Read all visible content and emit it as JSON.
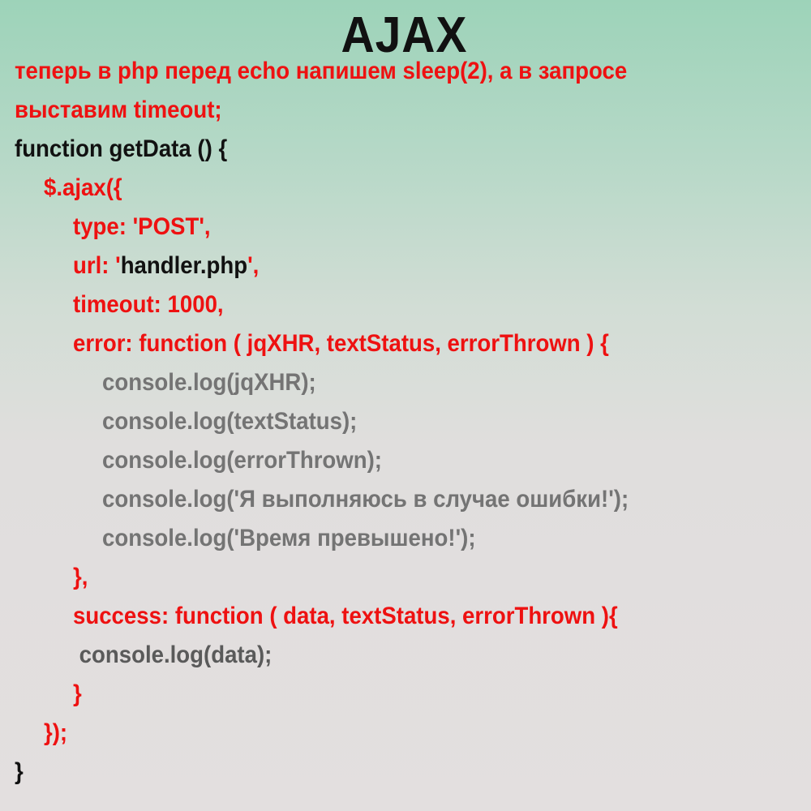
{
  "title": "AJAX",
  "colors": {
    "accent": "#ee1111",
    "text": "#111111",
    "muted": "#747474"
  },
  "intro": {
    "line1": "теперь в php перед echo напишем sleep(2), а в запросе",
    "line2": "выставим timeout;"
  },
  "code": {
    "fn_open": "function getData () {",
    "ajax_open": "$.ajax({",
    "type_line": "type: 'POST',",
    "url_key": "url: '",
    "url_value": "handler.php",
    "url_end": "',",
    "timeout_line": "timeout: 1000,",
    "error_open": "error: function ( jqXHR, textStatus, errorThrown ) {",
    "error_body": [
      "console.log(jqXHR);",
      "console.log(textStatus);",
      "console.log(errorThrown);",
      "console.log('Я выполняюсь в случае ошибки!');",
      "console.log('Время превышено!');"
    ],
    "error_close": "},",
    "success_open": "success: function ( data, textStatus, errorThrown ){",
    "success_body": " console.log(data);",
    "success_close": "}",
    "ajax_close": "});",
    "fn_close": "}"
  }
}
